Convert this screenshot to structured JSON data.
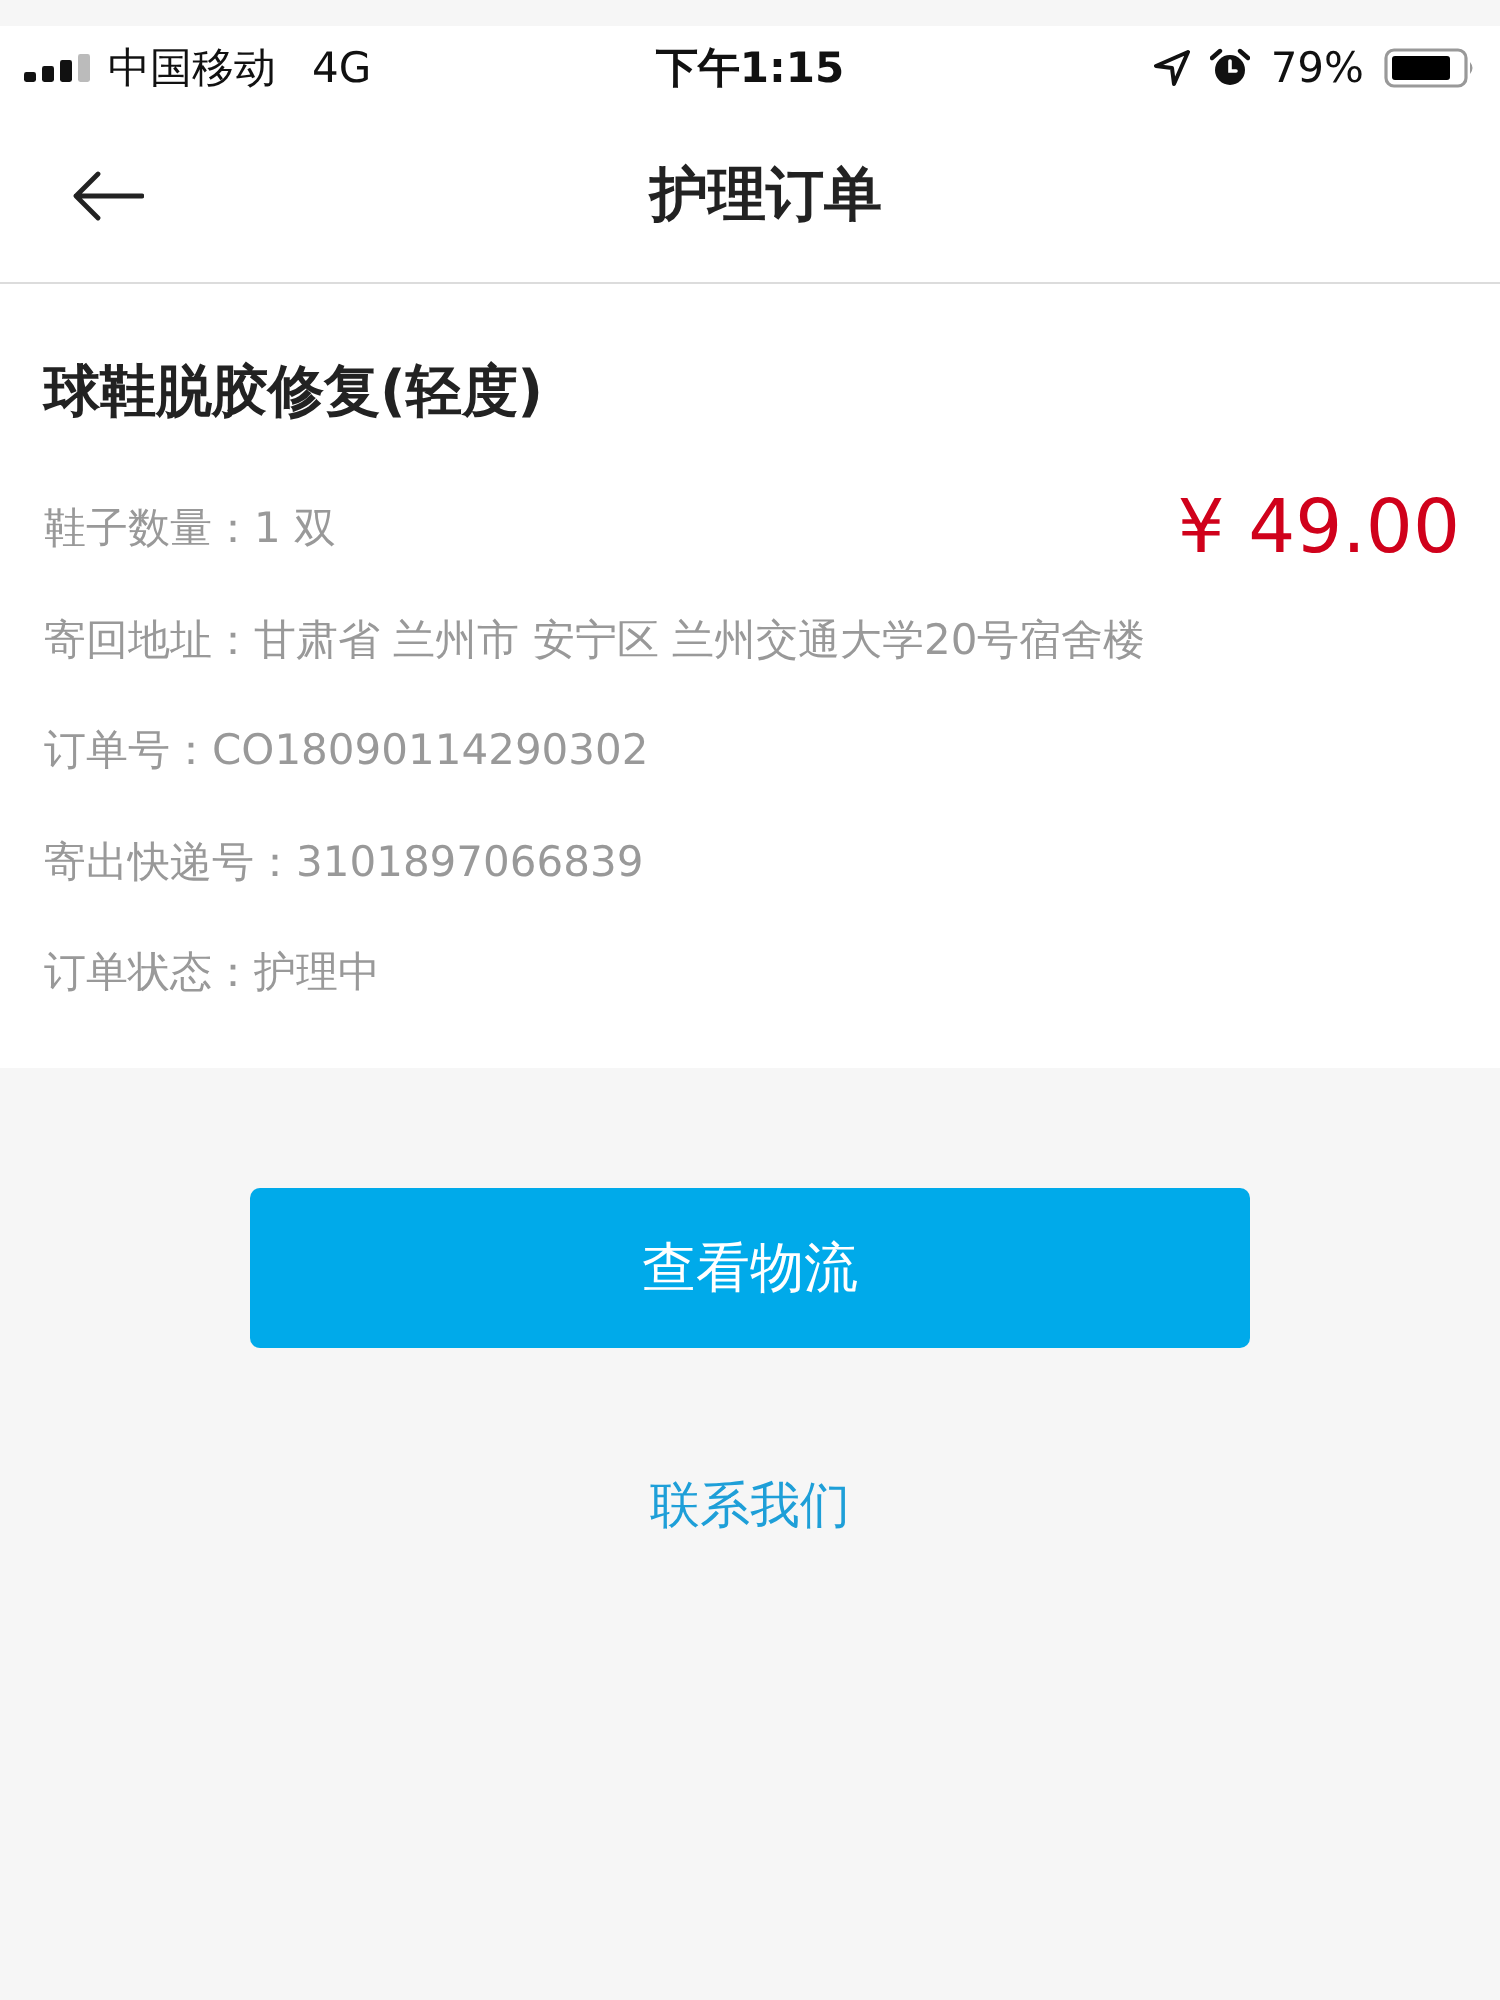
{
  "status_bar": {
    "carrier": "中国移动",
    "network": "4G",
    "time": "下午1:15",
    "battery_percent": "79%"
  },
  "nav_bar": {
    "title": "护理订单"
  },
  "order": {
    "title": "球鞋脱胶修复(轻度)",
    "price": "¥ 49.00",
    "details": [
      "鞋子数量：1 双",
      "寄回地址：甘肃省 兰州市 安宁区 兰州交通大学20号宿舍楼",
      "订单号：CO18090114290302",
      "寄出快递号：3101897066839",
      "订单状态：护理中"
    ]
  },
  "actions": {
    "primary_button": "查看物流",
    "contact_link": "联系我们"
  }
}
